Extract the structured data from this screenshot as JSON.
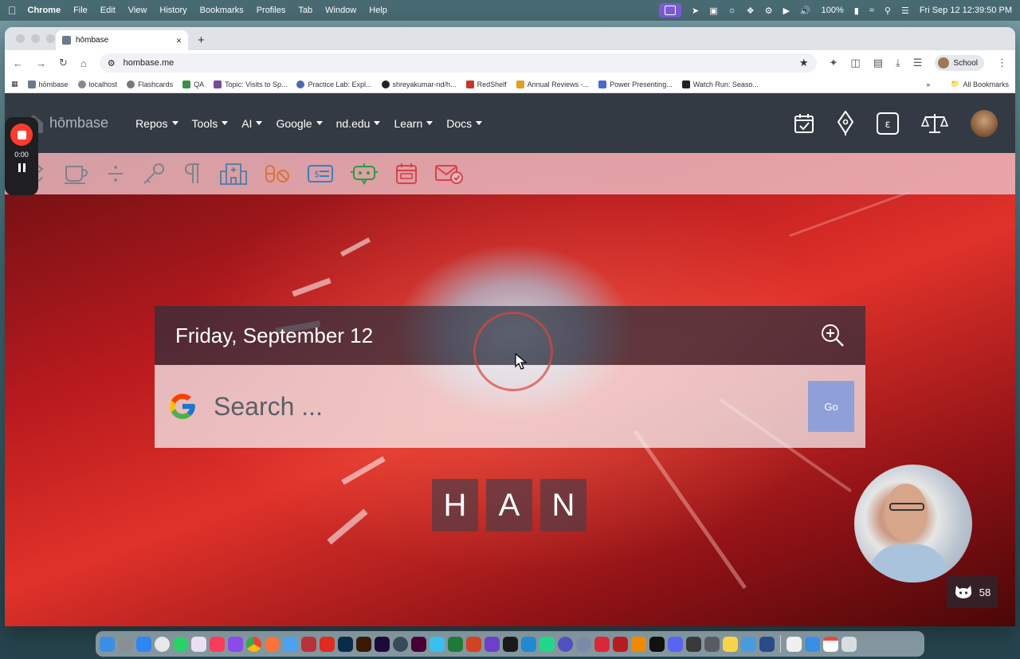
{
  "menubar": {
    "app": "Chrome",
    "items": [
      "File",
      "Edit",
      "View",
      "History",
      "Bookmarks",
      "Profiles",
      "Tab",
      "Window",
      "Help"
    ],
    "battery": "100%",
    "datetime": "Fri Sep 12  12:39:50 PM"
  },
  "browser": {
    "tab_title": "hōmbase",
    "url": "hombase.me",
    "profile": "School",
    "bookmarks": [
      {
        "label": "hōmbase",
        "color": "#6a7a8a"
      },
      {
        "label": "localhost",
        "color": "#888888"
      },
      {
        "label": "Flashcards",
        "color": "#777777"
      },
      {
        "label": "QA",
        "color": "#3a8f4a"
      },
      {
        "label": "Topic: Visits to Sp...",
        "color": "#7a4a9a"
      },
      {
        "label": "Practice Lab: Expl...",
        "color": "#4a6ab0"
      },
      {
        "label": "shreyakumar-nd/h...",
        "color": "#222222"
      },
      {
        "label": "RedShelf",
        "color": "#c0392b"
      },
      {
        "label": "Annual Reviews -...",
        "color": "#e0a020"
      },
      {
        "label": "Power Presenting...",
        "color": "#4a6ad0"
      },
      {
        "label": "Watch Run: Seaso...",
        "color": "#222222"
      }
    ],
    "all_bookmarks": "All Bookmarks"
  },
  "site": {
    "brand": "hōmbase",
    "nav": [
      "Repos",
      "Tools",
      "AI",
      "Google",
      "nd.edu",
      "Learn",
      "Docs"
    ],
    "date": "Friday, September 12",
    "search_placeholder": "Search ...",
    "go_label": "Go",
    "initials": [
      "H",
      "A",
      "N"
    ],
    "github_count": "58"
  },
  "recorder": {
    "time": "0:00"
  },
  "colors": {
    "navbar": "#343a43",
    "go_button": "#8fa0d8",
    "quickbar": "#ecbec4",
    "record_red": "#ff3b30"
  }
}
